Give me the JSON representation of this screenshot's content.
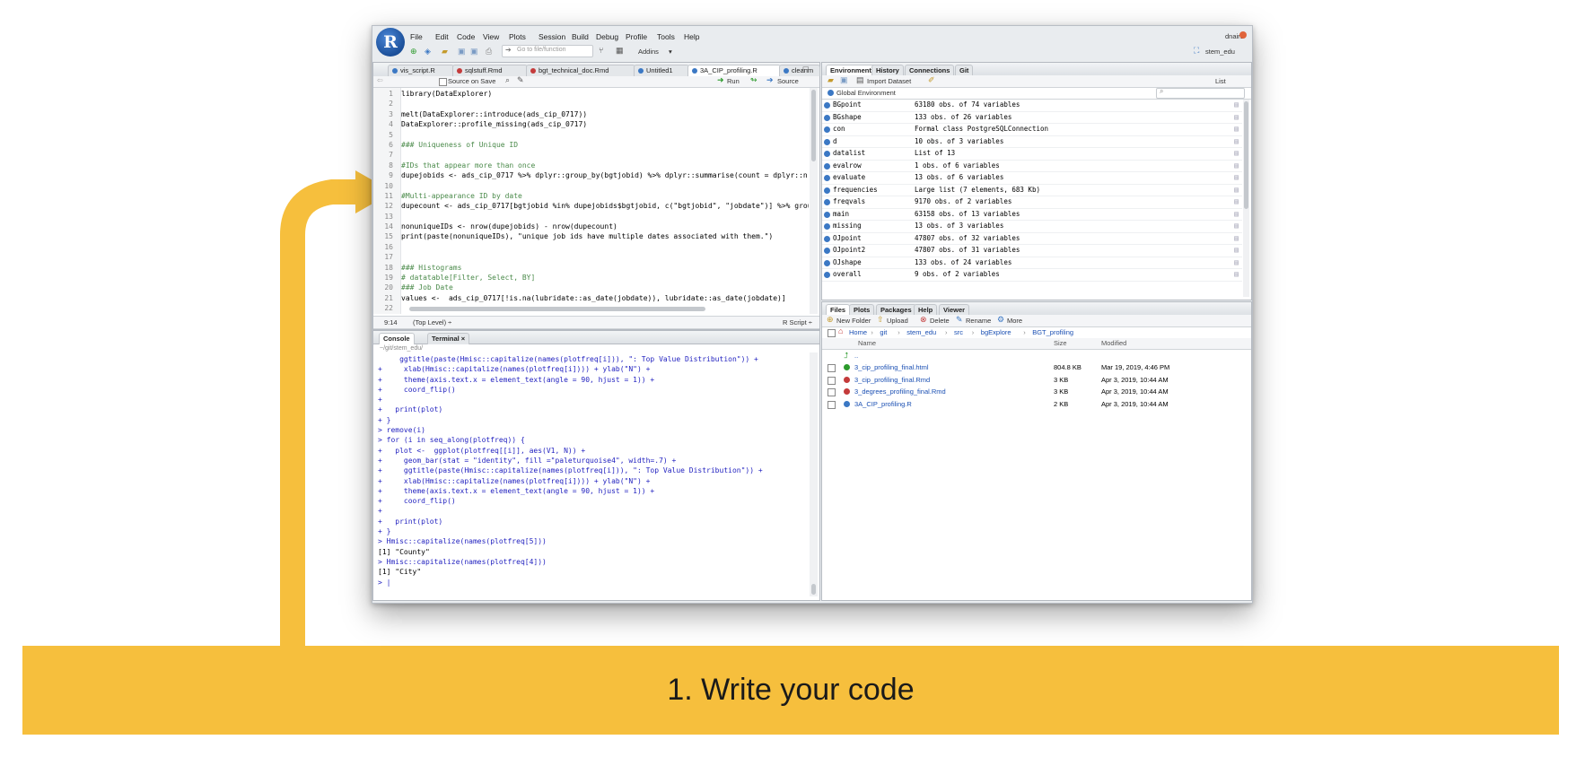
{
  "window": {
    "logo_letter": "R",
    "menu": [
      "File",
      "Edit",
      "Code",
      "View",
      "Plots",
      "Session",
      "Build",
      "Debug",
      "Profile",
      "Tools",
      "Help"
    ],
    "user": "dnair1",
    "project": "stem_edu",
    "goto_placeholder": "Go to file/function",
    "addins_label": "Addins"
  },
  "editor": {
    "tabs": [
      "vis_script.R",
      "sqlstuff.Rmd",
      "bgt_technical_doc.Rmd",
      "Untitled1",
      "3A_CIP_profiling.R",
      "cleanm"
    ],
    "active_tab": "3A_CIP_profiling.R",
    "source_on_save": "Source on Save",
    "run_label": "Run",
    "source_label": "Source",
    "lines": [
      {
        "n": "1",
        "text": "library(DataExplorer)",
        "kind": "code"
      },
      {
        "n": "2",
        "text": "",
        "kind": "code"
      },
      {
        "n": "3",
        "text": "melt(DataExplorer::introduce(ads_cip_0717))",
        "kind": "code"
      },
      {
        "n": "4",
        "text": "DataExplorer::profile_missing(ads_cip_0717)",
        "kind": "code"
      },
      {
        "n": "5",
        "text": "",
        "kind": "code"
      },
      {
        "n": "6",
        "text": "### Uniqueness of Unique ID",
        "kind": "comment"
      },
      {
        "n": "7",
        "text": "",
        "kind": "code"
      },
      {
        "n": "8",
        "text": "#IDs that appear more than once",
        "kind": "comment"
      },
      {
        "n": "9",
        "text": "dupejobids <- ads_cip_0717 %>% dplyr::group_by(bgtjobid) %>% dplyr::summarise(count = dplyr::n()) %>% dp",
        "kind": "code"
      },
      {
        "n": "10",
        "text": "",
        "kind": "code"
      },
      {
        "n": "11",
        "text": "#Multi-appearance ID by date",
        "kind": "comment"
      },
      {
        "n": "12",
        "text": "dupecount <- ads_cip_0717[bgtjobid %in% dupejobids$bgtjobid, c(\"bgtjobid\", \"jobdate\")] %>% group_by(bgt",
        "kind": "code"
      },
      {
        "n": "13",
        "text": "",
        "kind": "code"
      },
      {
        "n": "14",
        "text": "nonuniqueIDs <- nrow(dupejobids) - nrow(dupecount)",
        "kind": "code"
      },
      {
        "n": "15",
        "text": "print(paste(nonuniqueIDs), \"unique job ids have multiple dates associated with them.\")",
        "kind": "code"
      },
      {
        "n": "16",
        "text": "",
        "kind": "code"
      },
      {
        "n": "17",
        "text": "",
        "kind": "code"
      },
      {
        "n": "18",
        "text": "### Histograms",
        "kind": "comment"
      },
      {
        "n": "19",
        "text": "# datatable[Filter, Select, BY]",
        "kind": "comment"
      },
      {
        "n": "20",
        "text": "### Job Date",
        "kind": "comment"
      },
      {
        "n": "21",
        "text": "values <-  ads_cip_0717[!is.na(lubridate::as_date(jobdate)), lubridate::as_date(jobdate)]",
        "kind": "code"
      },
      {
        "n": "22",
        "text": "",
        "kind": "code"
      }
    ],
    "status_pos": "9:14",
    "status_scope": "(Top Level) ÷",
    "status_type": "R Script ÷"
  },
  "console": {
    "tabs": [
      "Console",
      "Terminal ×"
    ],
    "path": "~/git/stem_edu/",
    "lines": [
      {
        "text": "     ggtitle(paste(Hmisc::capitalize(names(plotfreq[i])), \": Top Value Distribution\")) +",
        "c": "blue"
      },
      {
        "text": "+     xlab(Hmisc::capitalize(names(plotfreq[i]))) + ylab(\"N\") +",
        "c": "blue"
      },
      {
        "text": "+     theme(axis.text.x = element_text(angle = 90, hjust = 1)) +",
        "c": "blue"
      },
      {
        "text": "+     coord_flip()",
        "c": "blue"
      },
      {
        "text": "+",
        "c": "blue"
      },
      {
        "text": "+   print(plot)",
        "c": "blue"
      },
      {
        "text": "+ }",
        "c": "blue"
      },
      {
        "text": "> remove(i)",
        "c": "blue"
      },
      {
        "text": "> for (i in seq_along(plotfreq)) {",
        "c": "blue"
      },
      {
        "text": "+   plot <-  ggplot(plotfreq[[i]], aes(V1, N)) +",
        "c": "blue"
      },
      {
        "text": "+     geom_bar(stat = \"identity\", fill =\"paleturquoise4\", width=.7) +",
        "c": "blue"
      },
      {
        "text": "+     ggtitle(paste(Hmisc::capitalize(names(plotfreq[i])), \": Top Value Distribution\")) +",
        "c": "blue"
      },
      {
        "text": "+     xlab(Hmisc::capitalize(names(plotfreq[i]))) + ylab(\"N\") +",
        "c": "blue"
      },
      {
        "text": "+     theme(axis.text.x = element_text(angle = 90, hjust = 1)) +",
        "c": "blue"
      },
      {
        "text": "+     coord_flip()",
        "c": "blue"
      },
      {
        "text": "+",
        "c": "blue"
      },
      {
        "text": "+   print(plot)",
        "c": "blue"
      },
      {
        "text": "+ }",
        "c": "blue"
      },
      {
        "text": "> Hmisc::capitalize(names(plotfreq[5]))",
        "c": "blue"
      },
      {
        "text": "[1] \"County\"",
        "c": "black"
      },
      {
        "text": "> Hmisc::capitalize(names(plotfreq[4]))",
        "c": "blue"
      },
      {
        "text": "[1] \"City\"",
        "c": "black"
      },
      {
        "text": "> |",
        "c": "blue"
      }
    ]
  },
  "environment": {
    "tabs": [
      "Environment",
      "History",
      "Connections",
      "Git"
    ],
    "import_label": "Import Dataset",
    "list_label": "List",
    "global_env": "Global Environment",
    "rows": [
      {
        "name": "BGpoint",
        "value": "63180 obs. of 74 variables"
      },
      {
        "name": "BGshape",
        "value": "133 obs. of 26 variables"
      },
      {
        "name": "con",
        "value": "Formal class PostgreSQLConnection"
      },
      {
        "name": "d",
        "value": "10 obs. of 3 variables"
      },
      {
        "name": "datalist",
        "value": "List of 13"
      },
      {
        "name": "evalrow",
        "value": "1 obs. of 6 variables"
      },
      {
        "name": "evaluate",
        "value": "13 obs. of 6 variables"
      },
      {
        "name": "frequencies",
        "value": "Large list (7 elements, 683 Kb)"
      },
      {
        "name": "freqvals",
        "value": "9170 obs. of 2 variables"
      },
      {
        "name": "main",
        "value": "63158 obs. of 13 variables"
      },
      {
        "name": "missing",
        "value": "13 obs. of 3 variables"
      },
      {
        "name": "OJpoint",
        "value": "47807 obs. of 32 variables"
      },
      {
        "name": "OJpoint2",
        "value": "47807 obs. of 31 variables"
      },
      {
        "name": "OJshape",
        "value": "133 obs. of 24 variables"
      },
      {
        "name": "overall",
        "value": "9 obs. of 2 variables"
      }
    ]
  },
  "files": {
    "tabs": [
      "Files",
      "Plots",
      "Packages",
      "Help",
      "Viewer"
    ],
    "toolbar": [
      "New Folder",
      "Upload",
      "Delete",
      "Rename",
      "More"
    ],
    "breadcrumb": [
      "Home",
      "git",
      "stem_edu",
      "src",
      "bgExplore",
      "BGT_profiling"
    ],
    "columns": [
      "Name",
      "Size",
      "Modified"
    ],
    "up": "..",
    "rows": [
      {
        "name": "3_cip_profiling_final.html",
        "size": "804.8 KB",
        "modified": "Mar 19, 2019, 4:46 PM"
      },
      {
        "name": "3_cip_profiling_final.Rmd",
        "size": "3 KB",
        "modified": "Apr 3, 2019, 10:44 AM"
      },
      {
        "name": "3_degrees_profiling_final.Rmd",
        "size": "3 KB",
        "modified": "Apr 3, 2019, 10:44 AM"
      },
      {
        "name": "3A_CIP_profiling.R",
        "size": "2 KB",
        "modified": "Apr 3, 2019, 10:44 AM"
      }
    ]
  },
  "banner": {
    "text": "1. Write your code",
    "color": "#f6bf3d"
  }
}
